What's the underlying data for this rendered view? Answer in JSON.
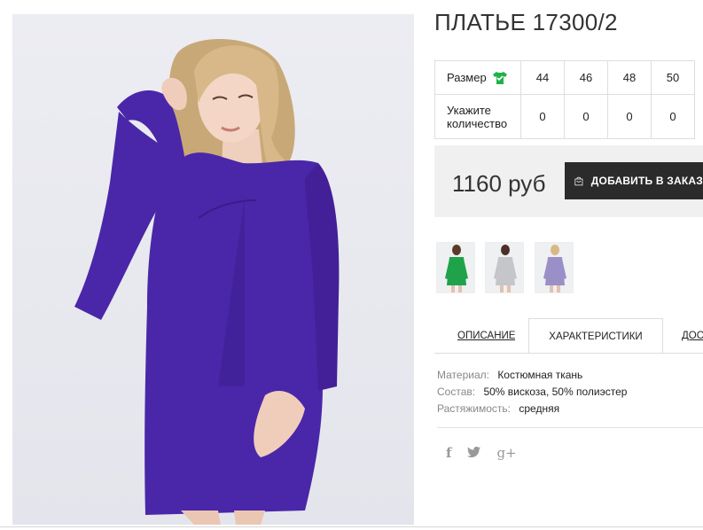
{
  "product": {
    "title": "ПЛАТЬЕ 17300/2",
    "price": "1160 руб",
    "add_to_cart_label": "ДОБАВИТЬ В ЗАКАЗ",
    "image_alt_color": "#4a27a8"
  },
  "size_table": {
    "size_label": "Размер",
    "size_icon": "green-shirt-icon",
    "qty_label": "Укажите количество",
    "sizes": [
      "44",
      "46",
      "48",
      "50"
    ],
    "quantities": [
      "0",
      "0",
      "0",
      "0"
    ]
  },
  "thumbnails": [
    {
      "name": "thumb-green-dress",
      "color": "#1fa24a"
    },
    {
      "name": "thumb-grey-dress",
      "color": "#c5c6c9"
    },
    {
      "name": "thumb-lavender-dress",
      "color": "#9a8fc7"
    }
  ],
  "tabs": [
    {
      "label": "ОПИСАНИЕ",
      "active": false
    },
    {
      "label": "ХАРАКТЕРИСТИКИ",
      "active": true
    },
    {
      "label": "ДОСТАВКА",
      "active": false
    }
  ],
  "specs": [
    {
      "key": "Материал:",
      "value": "Костюмная ткань"
    },
    {
      "key": "Состав:",
      "value": "50% вискоза, 50% полиэстер"
    },
    {
      "key": "Растяжимость:",
      "value": "средняя"
    }
  ],
  "social": {
    "facebook": "f",
    "twitter": "twitter-icon",
    "googleplus": "g+"
  },
  "colors": {
    "button_bg": "#2b2b2b",
    "buybox_bg": "#f0f0f0",
    "accent_green": "#1fb24a"
  }
}
